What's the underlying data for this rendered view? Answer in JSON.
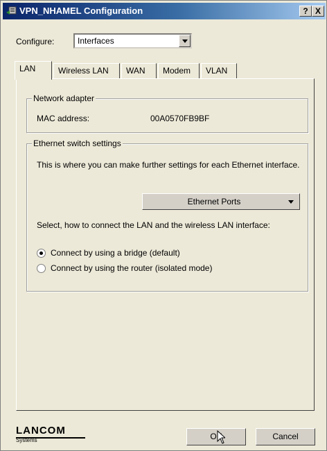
{
  "window": {
    "title": "VPN_NHAMEL Configuration",
    "help_label": "?",
    "close_label": "X"
  },
  "configure": {
    "label": "Configure:",
    "value": "Interfaces"
  },
  "tabs": [
    {
      "label": "LAN",
      "active": true
    },
    {
      "label": "Wireless LAN",
      "active": false
    },
    {
      "label": "WAN",
      "active": false
    },
    {
      "label": "Modem",
      "active": false
    },
    {
      "label": "VLAN",
      "active": false
    }
  ],
  "network_adapter": {
    "legend": "Network adapter",
    "mac_label": "MAC address:",
    "mac_value": "00A0570FB9BF"
  },
  "ethernet_switch": {
    "legend": "Ethernet switch settings",
    "description": "This is where you can make further settings for each Ethernet interface.",
    "ports_button": "Ethernet Ports",
    "select_text": "Select, how to connect the LAN and the wireless LAN interface:",
    "options": [
      {
        "label": "Connect by using a bridge (default)",
        "selected": true
      },
      {
        "label": "Connect by using the router (isolated mode)",
        "selected": false
      }
    ]
  },
  "footer": {
    "brand": "LANCOM",
    "brand_sub": "Systems",
    "ok_label": "OK",
    "cancel_label": "Cancel"
  }
}
